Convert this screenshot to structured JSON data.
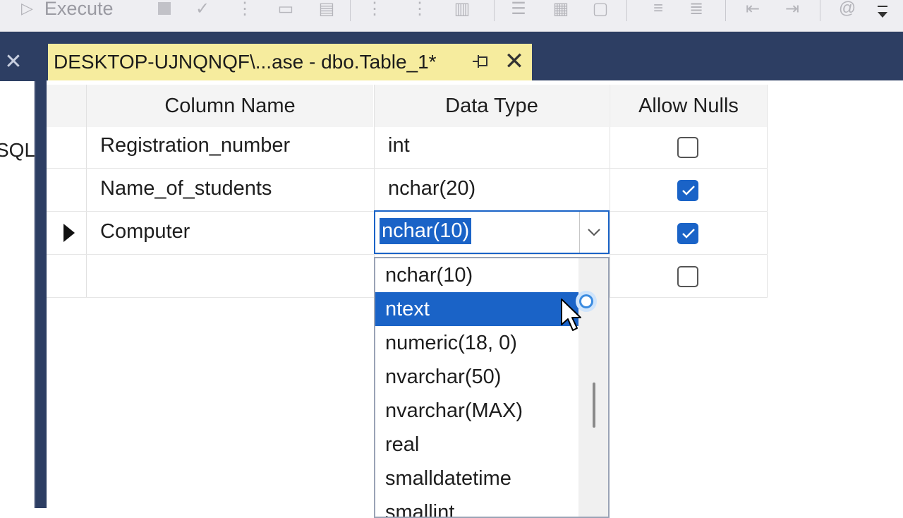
{
  "toolbar": {
    "execute_label": "Execute",
    "icons": [
      "execute-icon",
      "stop-icon",
      "check-icon",
      "query-options-icon",
      "results-text-icon",
      "results-grid-icon",
      "results-file-icon",
      "comment-icon",
      "uncomment-icon",
      "decrease-indent-icon",
      "increase-indent-icon",
      "specify-values-icon",
      "overflow-icon"
    ]
  },
  "document": {
    "tab_title": "DESKTOP-UJNQNQF\\...ase - dbo.Table_1*",
    "pin_icon": "pin-icon",
    "close_icon": "close-icon"
  },
  "left_panel": {
    "peek_text": "SQL",
    "close_icon": "close-icon"
  },
  "table_designer": {
    "columns": [
      "Column Name",
      "Data Type",
      "Allow Nulls"
    ],
    "rows": [
      {
        "name": "Registration_number",
        "type": "int",
        "allow_nulls": false
      },
      {
        "name": "Name_of_students",
        "type": "nchar(20)",
        "allow_nulls": true
      },
      {
        "name": "Computer",
        "type": "nchar(10)",
        "allow_nulls": true,
        "current": true
      },
      {
        "name": "",
        "type": "",
        "allow_nulls": false
      }
    ],
    "active_cell_value": "nchar(10)",
    "dropdown_options": [
      "nchar(10)",
      "ntext",
      "numeric(18, 0)",
      "nvarchar(50)",
      "nvarchar(MAX)",
      "real",
      "smalldatetime",
      "smallint"
    ],
    "highlighted_option": "ntext"
  },
  "colors": {
    "accent": "#1a63c7",
    "tab_active": "#f6ec9e",
    "frame": "#2d3e63"
  }
}
